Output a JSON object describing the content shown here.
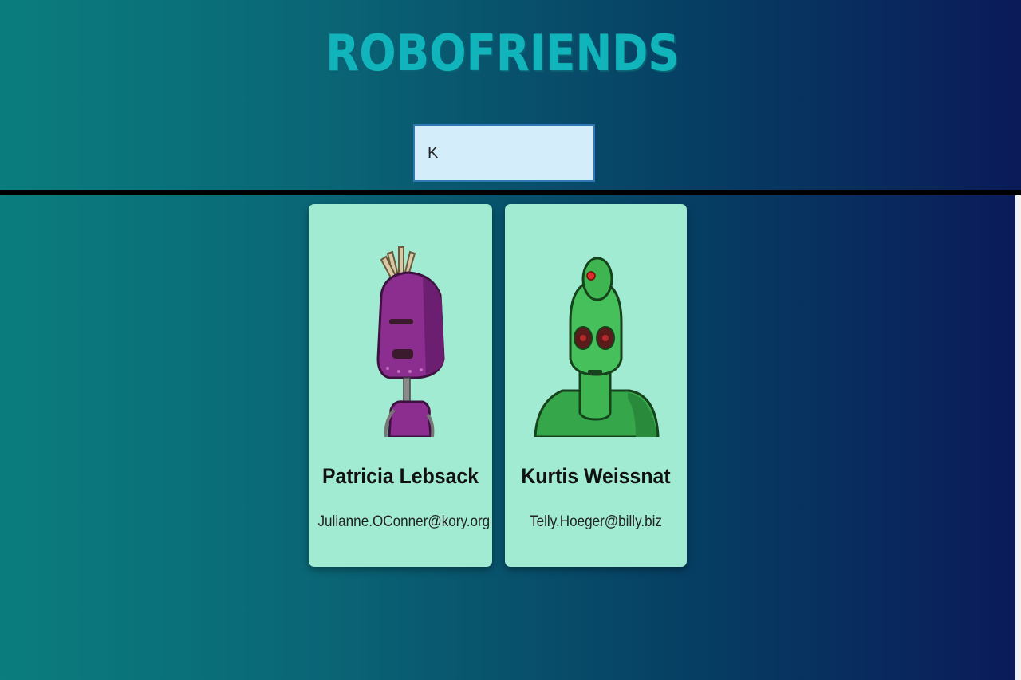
{
  "app": {
    "title": "ROBOFRIENDS",
    "colors": {
      "title": "#12b4bb",
      "card_bg": "#a2ebd3",
      "search_bg": "#d3edfb"
    }
  },
  "search": {
    "value": "K",
    "placeholder": ""
  },
  "robots": [
    {
      "name": "Patricia Lebsack",
      "email": "Julianne.OConner@kory.org",
      "avatar": "purple-robot-icon"
    },
    {
      "name": "Kurtis Weissnat",
      "email": "Telly.Hoeger@billy.biz",
      "avatar": "green-robot-icon"
    }
  ]
}
